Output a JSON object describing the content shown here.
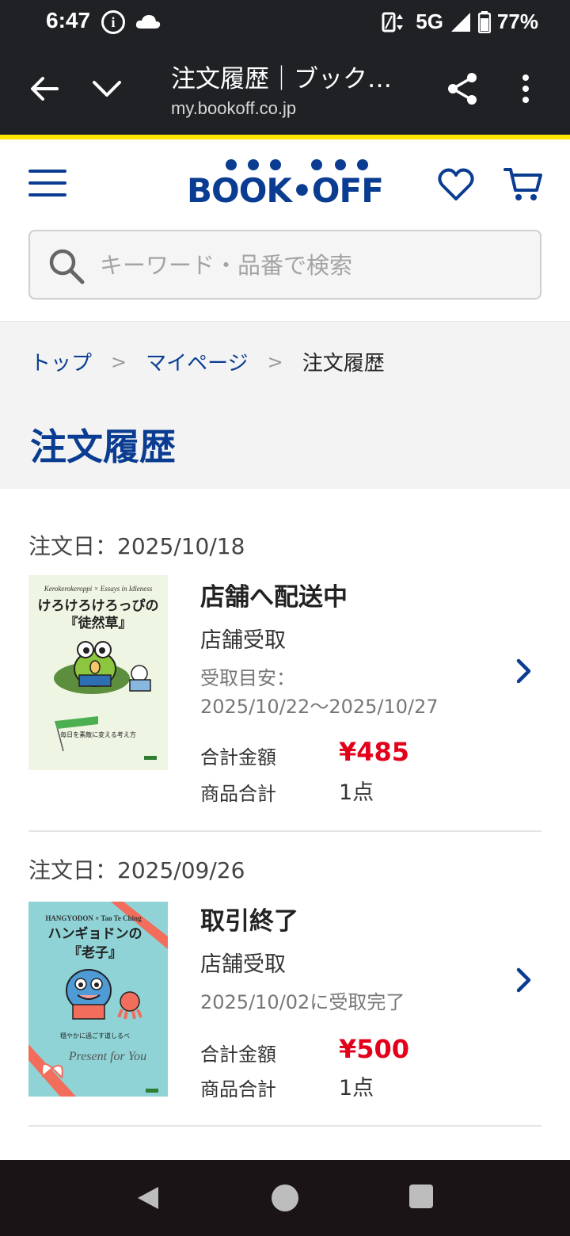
{
  "status_bar": {
    "time": "6:47",
    "network": "5G",
    "battery": "77%"
  },
  "browser": {
    "title": "注文履歴｜ブック…",
    "url": "my.bookoff.co.jp"
  },
  "site": {
    "logo_text": "BOOK•OFF",
    "brand_color": "#0a3d91",
    "accent_color": "#ffe600",
    "search_placeholder": "キーワード・品番で検索"
  },
  "breadcrumb": {
    "items": [
      "トップ",
      "マイページ"
    ],
    "current": "注文履歴"
  },
  "page_title": "注文履歴",
  "orders": [
    {
      "date": "注文日：2025/10/18",
      "status": "店舗へ配送中",
      "method": "店舗受取",
      "note_line1": "受取目安：",
      "note_line2": "2025/10/22〜2025/10/27",
      "total_label": "合計金額",
      "total": "¥485",
      "count_label": "商品合計",
      "count": "1点",
      "cover": {
        "en_title": "Kerokerokeroppi × Essays in Idleness",
        "title_line1": "けろけろけろっぴの",
        "title_line2": "『徒然草』",
        "subtitle": "毎日を素敵に変える考え方",
        "bg_color": "#eef5e2"
      }
    },
    {
      "date": "注文日：2025/09/26",
      "status": "取引終了",
      "method": "店舗受取",
      "note_line1": "2025/10/02に受取完了",
      "total_label": "合計金額",
      "total": "¥500",
      "count_label": "商品合計",
      "count": "1点",
      "cover": {
        "en_title": "HANGYODON × Tao Te Ching",
        "title_line1": "ハンギョドンの",
        "title_line2": "『老子』",
        "subtitle": "穏やかに過ごす道しるべ",
        "script": "Present for You",
        "bg_color": "#8fd3d6"
      }
    }
  ],
  "price_color": "#e2001a"
}
